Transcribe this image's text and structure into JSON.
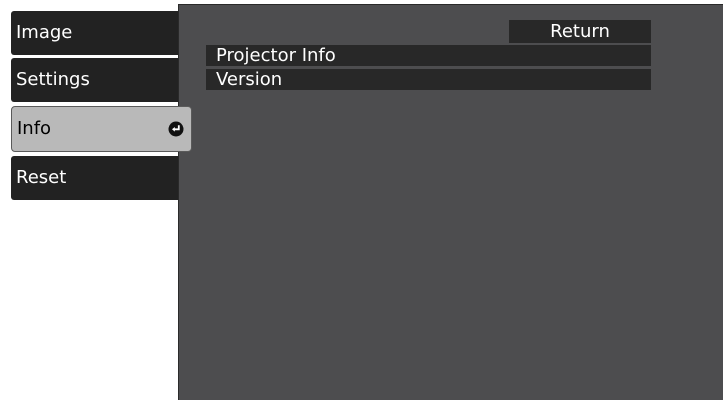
{
  "sidebar": {
    "items": [
      {
        "label": "Image"
      },
      {
        "label": "Settings"
      },
      {
        "label": "Info",
        "selected": true,
        "icon": "enter-icon"
      },
      {
        "label": "Reset"
      }
    ]
  },
  "main": {
    "return_label": "Return",
    "items": [
      {
        "label": "Projector Info"
      },
      {
        "label": "Version"
      }
    ]
  },
  "colors": {
    "panel_bg": "#4d4d4f",
    "tab_bg": "#222222",
    "selected_tab_bg": "#b9b9b9",
    "item_bg": "#282828",
    "text": "#ffffff"
  }
}
